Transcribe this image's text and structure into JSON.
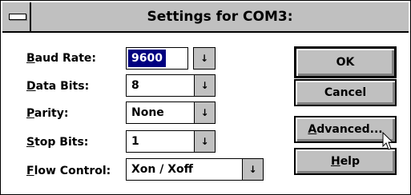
{
  "window": {
    "title": "Settings for COM3:"
  },
  "fields": [
    {
      "label_accel": "B",
      "label_rest": "aud Rate:",
      "value": "9600"
    },
    {
      "label_accel": "D",
      "label_rest": "ata Bits:",
      "value": "8"
    },
    {
      "label_accel": "P",
      "label_rest": "arity:",
      "value": "None"
    },
    {
      "label_accel": "S",
      "label_rest": "top Bits:",
      "value": "1"
    },
    {
      "label_accel": "F",
      "label_rest": "low Control:",
      "value": "Xon / Xoff"
    }
  ],
  "buttons": {
    "ok": {
      "label": "OK"
    },
    "cancel": {
      "label": "Cancel"
    },
    "advanced": {
      "accel": "A",
      "rest": "dvanced..."
    },
    "help": {
      "accel": "H",
      "rest": "elp"
    }
  },
  "icons": {
    "dropdown": "down-arrow-to-bar-icon",
    "system_menu": "system-menu-icon",
    "cursor": "mouse-pointer-icon"
  },
  "colors": {
    "title_bar": "#c0c0c0",
    "selection": "#000080",
    "face": "#c0c0c0"
  }
}
